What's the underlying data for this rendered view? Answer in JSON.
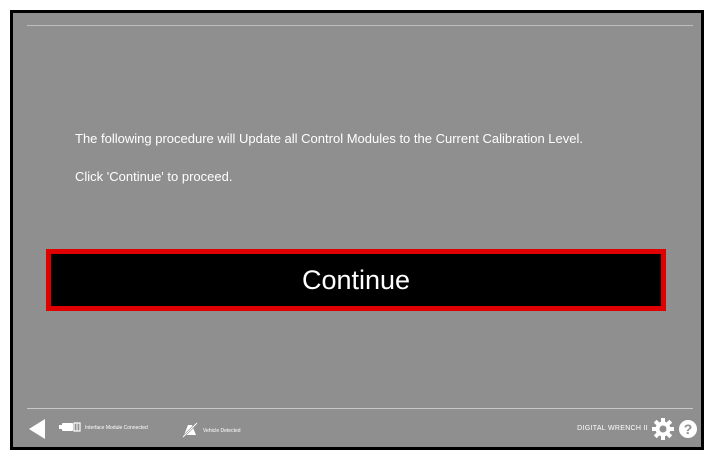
{
  "message": {
    "line1": "The following procedure will Update all Control Modules to the Current Calibration Level.",
    "line2": "Click 'Continue' to proceed."
  },
  "continue_button": {
    "label": "Continue"
  },
  "footer": {
    "interface_status": "Interface Module Connected",
    "vehicle_status": "Vehicle Detected",
    "brand": "DIGITAL WRENCH II",
    "help_label": "?"
  },
  "icons": {
    "back": "back-arrow-icon",
    "interface": "interface-module-icon",
    "vehicle": "vehicle-detected-icon",
    "settings": "gear-icon",
    "help": "help-icon"
  },
  "colors": {
    "background": "#8f8f8f",
    "button_fill": "#000000",
    "button_border": "#e00000",
    "text": "#ffffff"
  }
}
